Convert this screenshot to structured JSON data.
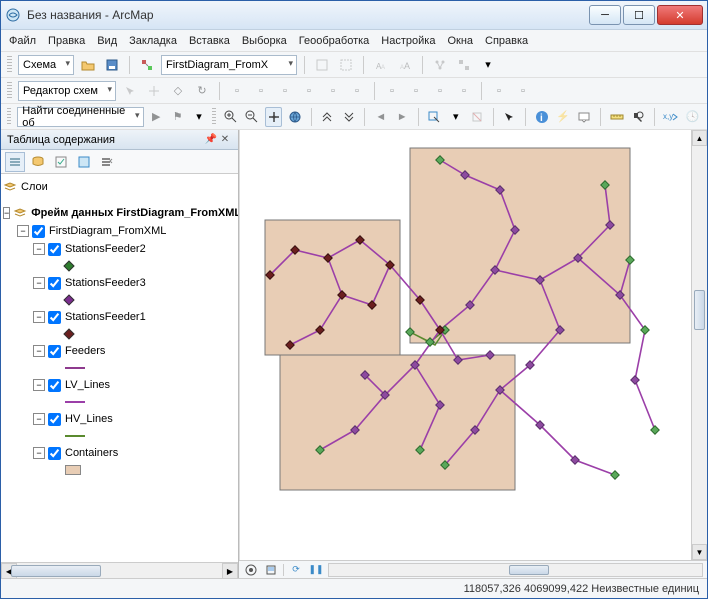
{
  "window": {
    "title": "Без названия - ArcMap"
  },
  "menu": [
    "Файл",
    "Правка",
    "Вид",
    "Закладка",
    "Вставка",
    "Выборка",
    "Геообработка",
    "Настройка",
    "Окна",
    "Справка"
  ],
  "toolbar1": {
    "label": "Схема",
    "combo": "FirstDiagram_FromX"
  },
  "toolbar2": {
    "label": "Редактор схем"
  },
  "toolbar3": {
    "combo": "Найти соединенные об"
  },
  "toc": {
    "title": "Таблица содержания",
    "root": "Слои",
    "frame": "Фрейм данных FirstDiagram_FromXML",
    "layer_group": "FirstDiagram_FromXML",
    "layers": [
      {
        "name": "StationsFeeder2",
        "sym": {
          "type": "point",
          "color": "#2e7d2e"
        }
      },
      {
        "name": "StationsFeeder3",
        "sym": {
          "type": "point",
          "color": "#7b2d8e"
        }
      },
      {
        "name": "StationsFeeder1",
        "sym": {
          "type": "point",
          "color": "#6b1f1f"
        }
      },
      {
        "name": "Feeders",
        "sym": {
          "type": "line",
          "color": "#8e3a8e"
        }
      },
      {
        "name": "LV_Lines",
        "sym": {
          "type": "line",
          "color": "#9b3fa8"
        }
      },
      {
        "name": "HV_Lines",
        "sym": {
          "type": "line",
          "color": "#5a8a2e"
        }
      },
      {
        "name": "Containers",
        "sym": {
          "type": "fill",
          "color": "#e8cdb5"
        }
      }
    ]
  },
  "status": "118057,326 4069099,422 Неизвестные единиц",
  "chart_data": {
    "type": "diagram",
    "note": "Schematic network diagram — three peach container rectangles with node/edge graph overlaid. Nodes are small diamonds (green, purple, dark-red). Edges are purple and green polylines connecting nodes. No numeric axes; positions are schematic, not geographic."
  }
}
